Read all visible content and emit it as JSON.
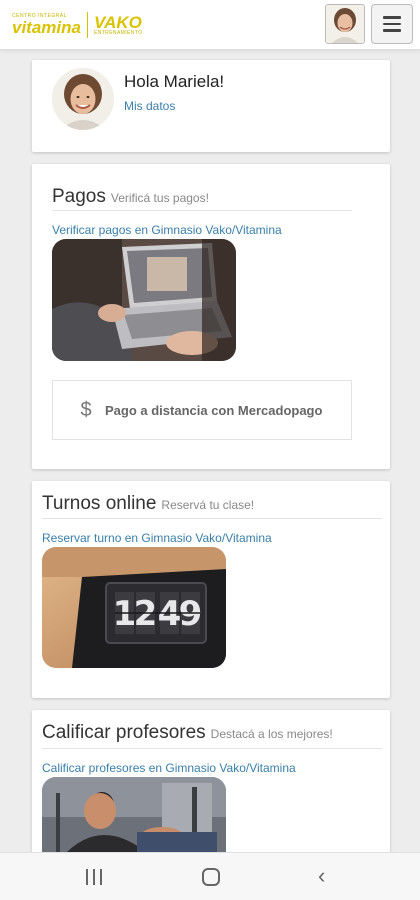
{
  "header": {
    "logo_vitamina_small": "CENTRO INTEGRAL",
    "logo_vitamina": "vitamina",
    "logo_vako": "VAKO",
    "logo_vako_small": "ENTRENAMIENTO",
    "avatar_icon": "user-avatar",
    "menu_icon": "hamburger-menu"
  },
  "profile": {
    "greeting": "Hola Mariela!",
    "link": "Mis datos"
  },
  "pagos": {
    "title": "Pagos",
    "subtitle": "Verificá tus pagos!",
    "link": "Verificar pagos en Gimnasio Vako/Vitamina",
    "button_icon": "dollar-icon",
    "button_label": "Pago a distancia con Mercadopago"
  },
  "turnos": {
    "title": "Turnos online",
    "subtitle": "Reservá tu clase!",
    "link": "Reservar turno en Gimnasio Vako/Vitamina",
    "clock_digits": [
      "1",
      "2",
      "4",
      "9"
    ]
  },
  "calificar": {
    "title": "Calificar profesores",
    "subtitle": "Destacá a los mejores!",
    "link": "Calificar profesores en Gimnasio Vako/Vitamina"
  },
  "navbar": {
    "recent_icon": "recent-apps-icon",
    "home_icon": "home-icon",
    "back_icon": "back-icon"
  },
  "colors": {
    "brand_yellow": "#d9c300",
    "link_blue": "#3a7fa8",
    "background": "#ededed"
  }
}
